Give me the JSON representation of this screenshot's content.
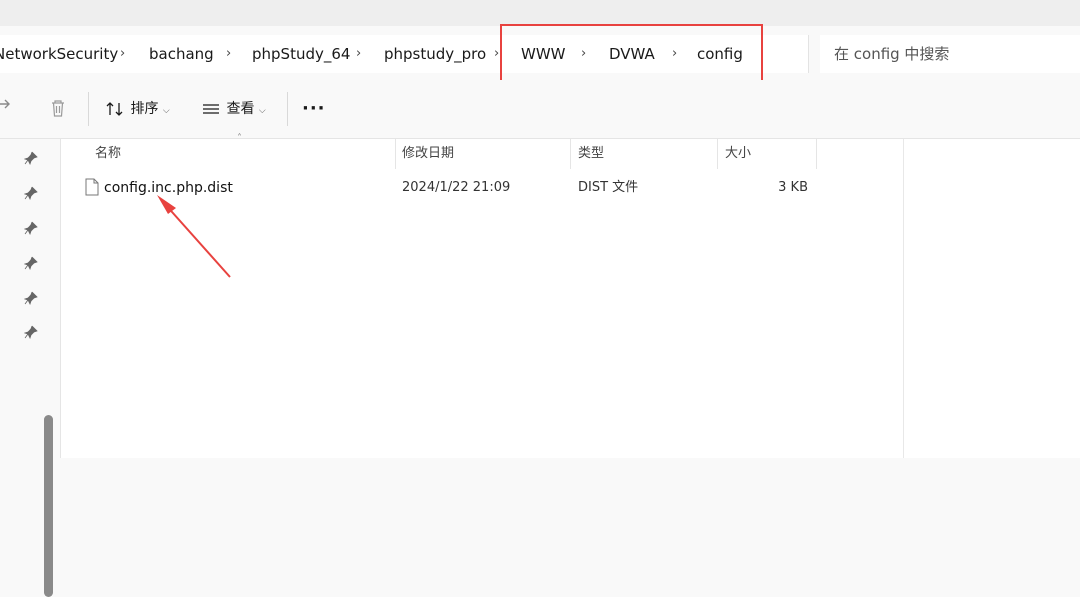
{
  "breadcrumb": [
    "NetworkSecurity",
    "bachang",
    "phpStudy_64",
    "phpstudy_pro",
    "WWW",
    "DVWA",
    "config"
  ],
  "search": {
    "placeholder": "在 config 中搜索"
  },
  "toolbar": {
    "share_icon": "share-icon",
    "delete_icon": "trash-icon",
    "sort_label": "排序",
    "view_label": "查看",
    "more_icon": "more-icon"
  },
  "columns": {
    "name": "名称",
    "modified": "修改日期",
    "type": "类型",
    "size": "大小"
  },
  "files": [
    {
      "name": "config.inc.php.dist",
      "modified": "2024/1/22 21:09",
      "type": "DIST 文件",
      "size": "3 KB"
    }
  ],
  "annotation_color": "#e8423f"
}
